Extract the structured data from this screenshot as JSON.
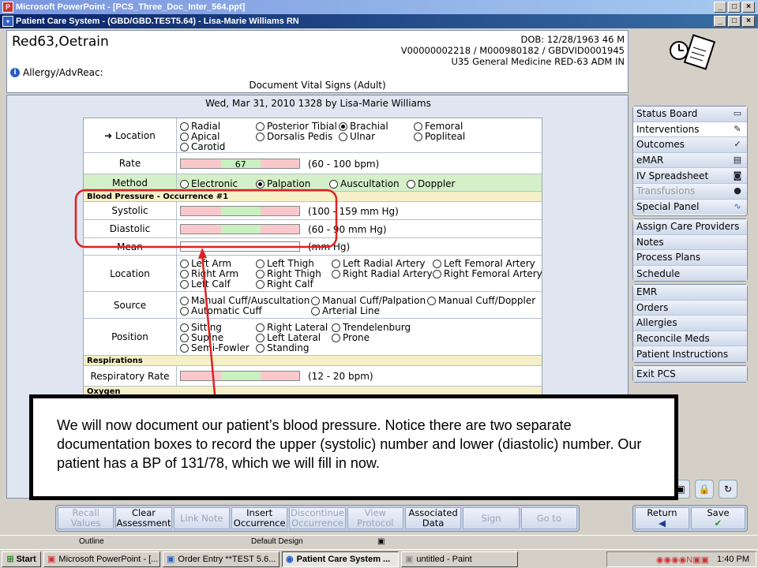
{
  "window": {
    "ppt_title": "Microsoft PowerPoint - [PCS_Three_Doc_Inter_564.ppt]",
    "pcs_title": "Patient Care System - (GBD/GBD.TEST5.64) - Lisa-Marie Williams RN"
  },
  "header": {
    "patient_name": "Red63,Oetrain",
    "dob": "DOB: 12/28/1963 46 M",
    "ids": "V00000002218 / M000980182 / GBDVID0001945",
    "location": "U35 General Medicine  RED-63  ADM IN",
    "allergy_label": "Allergy/AdvReac:",
    "doc_title": "Document Vital Signs (Adult)"
  },
  "main": {
    "date_line": "Wed,  Mar 31, 2010 1328  by  Lisa-Marie Williams"
  },
  "form": {
    "location_label": "Location",
    "location_options": [
      "Radial",
      "Posterior Tibial",
      "Brachial",
      "Femoral",
      "Apical",
      "Dorsalis Pedis",
      "Ulnar",
      "Popliteal",
      "Carotid"
    ],
    "rate_label": "Rate",
    "rate_value": "67",
    "rate_range": "(60 - 100 bpm)",
    "method_label": "Method",
    "method_options": [
      "Electronic",
      "Palpation",
      "Auscultation",
      "Doppler"
    ],
    "bp_header": "Blood Pressure - Occurrence #1",
    "systolic_label": "Systolic",
    "systolic_range": "(100 - 159 mm Hg)",
    "diastolic_label": "Diastolic",
    "diastolic_range": "(60 - 90 mm Hg)",
    "mean_label": "Mean",
    "mean_range": "(mm Hg)",
    "bp_location_label": "Location",
    "bp_location_options": [
      "Left Arm",
      "Left Thigh",
      "Left Radial Artery",
      "Left Femoral Artery",
      "Right Arm",
      "Right Thigh",
      "Right Radial Artery",
      "Right Femoral Artery",
      "Left Calf",
      "Right Calf"
    ],
    "source_label": "Source",
    "source_options": [
      "Manual Cuff/Auscultation",
      "Manual Cuff/Palpation",
      "Manual Cuff/Doppler",
      "Automatic Cuff",
      "Arterial Line"
    ],
    "position_label": "Position",
    "position_options": [
      "Sitting",
      "Right Lateral",
      "Trendelenburg",
      "Supine",
      "Left Lateral",
      "Prone",
      "Semi-Fowler",
      "Standing"
    ],
    "resp_header": "Respirations",
    "resp_label": "Respiratory Rate",
    "resp_range": "(12 - 20 bpm)",
    "oxygen_header": "Oxygen"
  },
  "nav": {
    "group1": [
      "Status Board",
      "Interventions",
      "Outcomes",
      "eMAR",
      "IV Spreadsheet",
      "Transfusions",
      "Special Panel"
    ],
    "group2": [
      "Assign Care Providers",
      "Notes",
      "Process Plans",
      "Schedule"
    ],
    "group3": [
      "EMR",
      "Orders",
      "Allergies",
      "Reconcile Meds",
      "Patient Instructions"
    ],
    "group4": [
      "Exit PCS"
    ]
  },
  "callout": {
    "text": "We will now document our patient’s blood pressure. Notice there are two separate documentation boxes to record the upper (systolic) number and lower (diastolic) number. Our patient has a BP of 131/78, which we will fill in now."
  },
  "toolbar": {
    "buttons": [
      "Recall Values",
      "Clear Assessment",
      "Link Note",
      "Insert Occurrence",
      "Discontinue Occurrence",
      "View Protocol",
      "Associated Data",
      "Sign",
      "Go to"
    ],
    "return_label": "Return",
    "save_label": "Save"
  },
  "ppt_status": {
    "outline": "Outline",
    "design": "Default Design"
  },
  "taskbar": {
    "start": "Start",
    "tasks": [
      "Microsoft PowerPoint - [...",
      "Order Entry **TEST 5.6...",
      "Patient Care System ...",
      "untitled - Paint"
    ],
    "clock": "1:40 PM"
  },
  "colors": {
    "title_active": "#0a246a",
    "annotation_red": "#e02020",
    "abnormal_pink": "#f8c8cc",
    "normal_green": "#c8f0c0"
  }
}
